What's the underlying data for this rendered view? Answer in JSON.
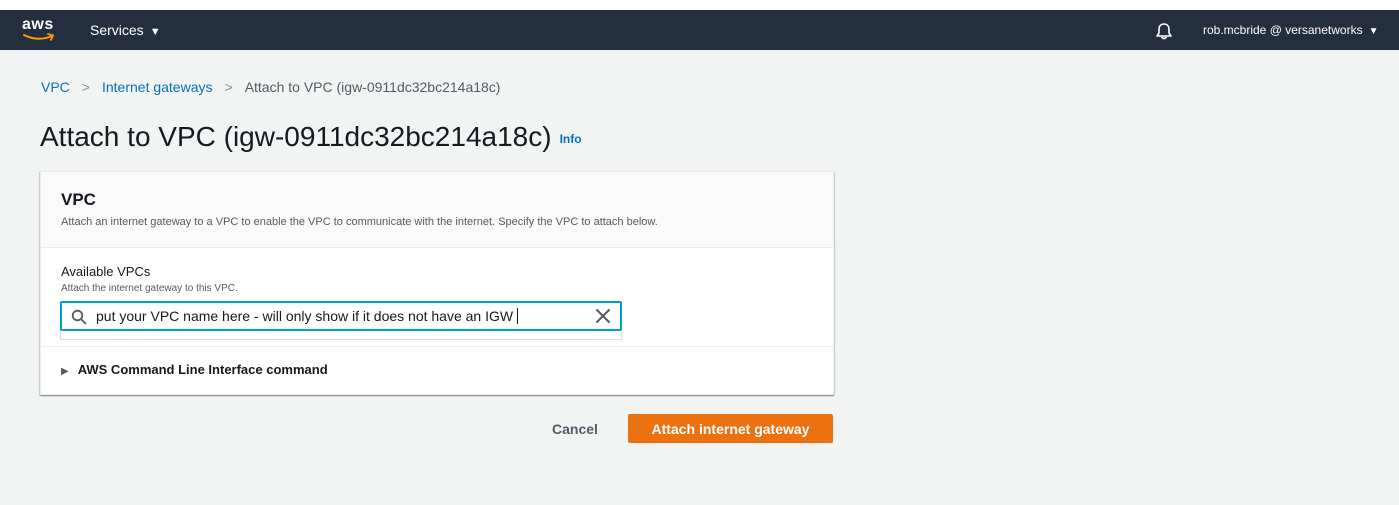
{
  "navbar": {
    "logo_text": "aws",
    "services_label": "Services",
    "account_label": "rob.mcbride @ versanetworks",
    "icons": {
      "bell": "bell-icon",
      "caret": "caret-down-icon"
    }
  },
  "breadcrumb": {
    "items": [
      {
        "label": "VPC",
        "link": true
      },
      {
        "label": "Internet gateways",
        "link": true
      },
      {
        "label": "Attach to VPC (igw-0911dc32bc214a18c)",
        "link": false
      }
    ]
  },
  "page": {
    "title": "Attach to VPC (igw-0911dc32bc214a18c)",
    "info_label": "Info"
  },
  "panel": {
    "title": "VPC",
    "description": "Attach an internet gateway to a VPC to enable the VPC to communicate with the internet. Specify the VPC to attach below.",
    "field": {
      "label": "Available VPCs",
      "description": "Attach the internet gateway to this VPC.",
      "value": "put your VPC name here - will only show if it does not have an IGW"
    },
    "cli_label": "AWS Command Line Interface command"
  },
  "actions": {
    "cancel_label": "Cancel",
    "attach_label": "Attach internet gateway"
  },
  "colors": {
    "nav_bg": "#232f3e",
    "link": "#0073bb",
    "primary": "#ec7211",
    "focus": "#00a1c9",
    "page_bg": "#f2f3f3"
  }
}
